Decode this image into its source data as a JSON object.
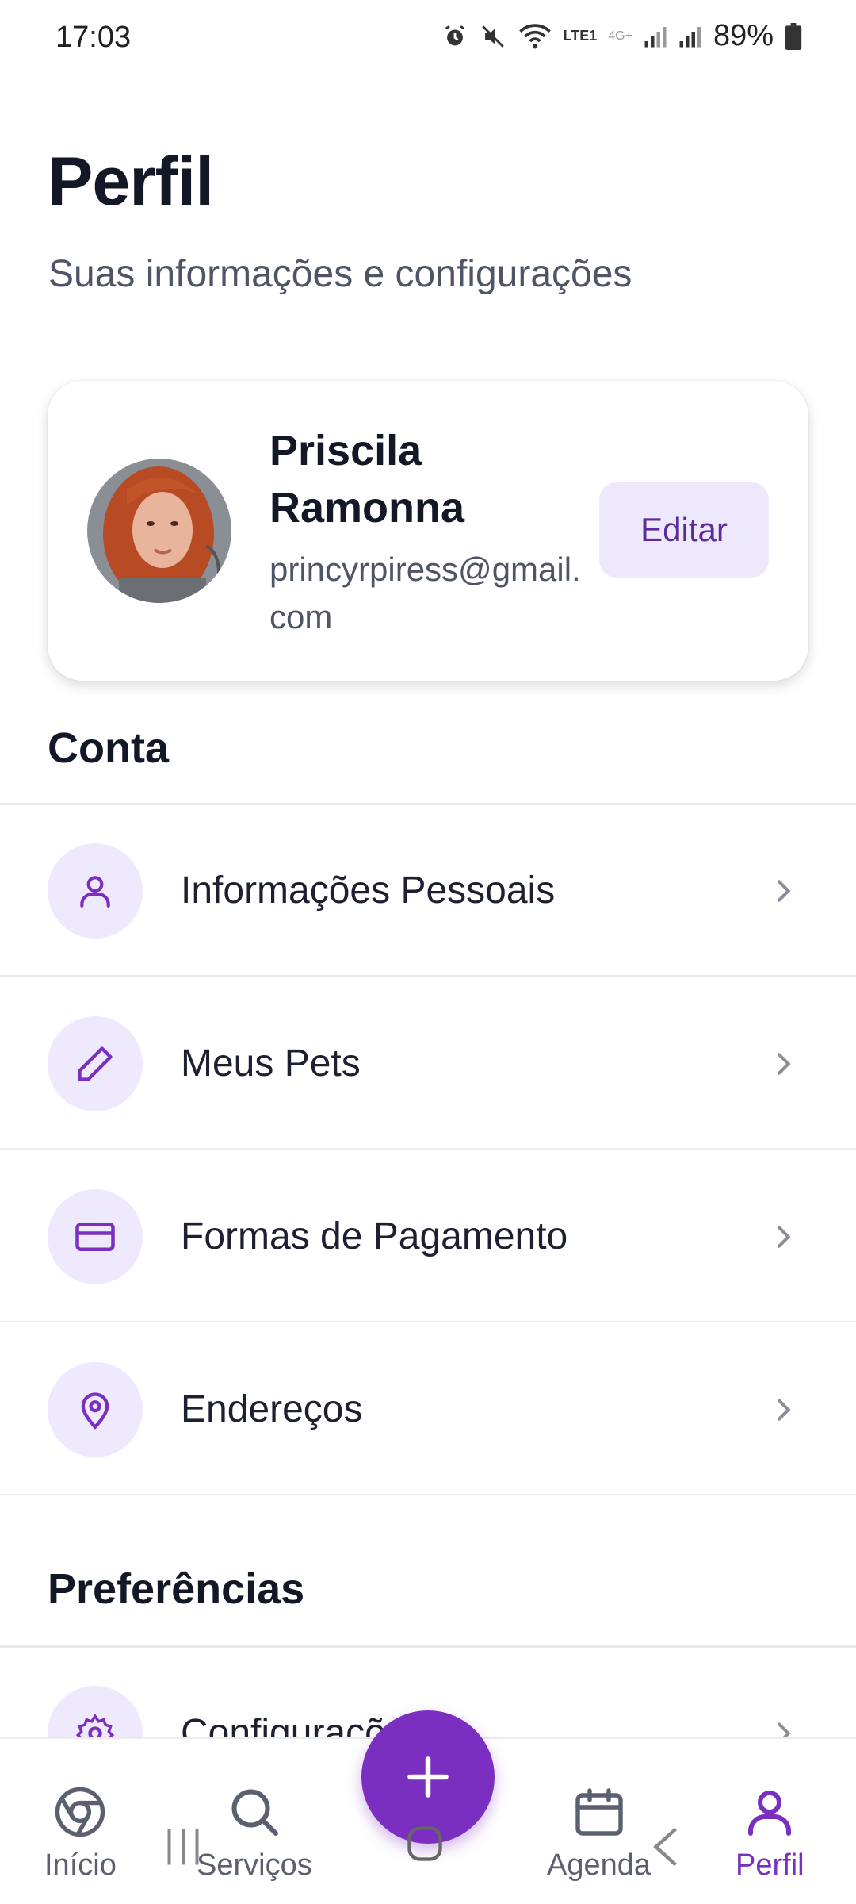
{
  "status_bar": {
    "time": "17:03",
    "network": "LTE1",
    "network_secondary": "4G+",
    "battery": "89%"
  },
  "header": {
    "title": "Perfil",
    "subtitle": "Suas informações e configurações"
  },
  "profile": {
    "name": "Priscila Ramonna",
    "email": "princyrpiress@gmail.com",
    "edit_label": "Editar"
  },
  "sections": {
    "account_title": "Conta",
    "preferences_title": "Preferências"
  },
  "account_items": [
    {
      "label": "Informações Pessoais",
      "icon": "user-icon"
    },
    {
      "label": "Meus Pets",
      "icon": "pencil-icon"
    },
    {
      "label": "Formas de Pagamento",
      "icon": "credit-card-icon"
    },
    {
      "label": "Endereços",
      "icon": "map-pin-icon"
    }
  ],
  "preferences_items": [
    {
      "label": "Configurações",
      "icon": "gear-icon"
    }
  ],
  "bottom_nav": {
    "home": "Início",
    "services": "Serviços",
    "schedule": "Agenda",
    "profile": "Perfil"
  },
  "colors": {
    "accent": "#7a2fc0",
    "accent_soft": "#efe9fd",
    "text_dark": "#121826",
    "text_muted": "#4e5566"
  }
}
